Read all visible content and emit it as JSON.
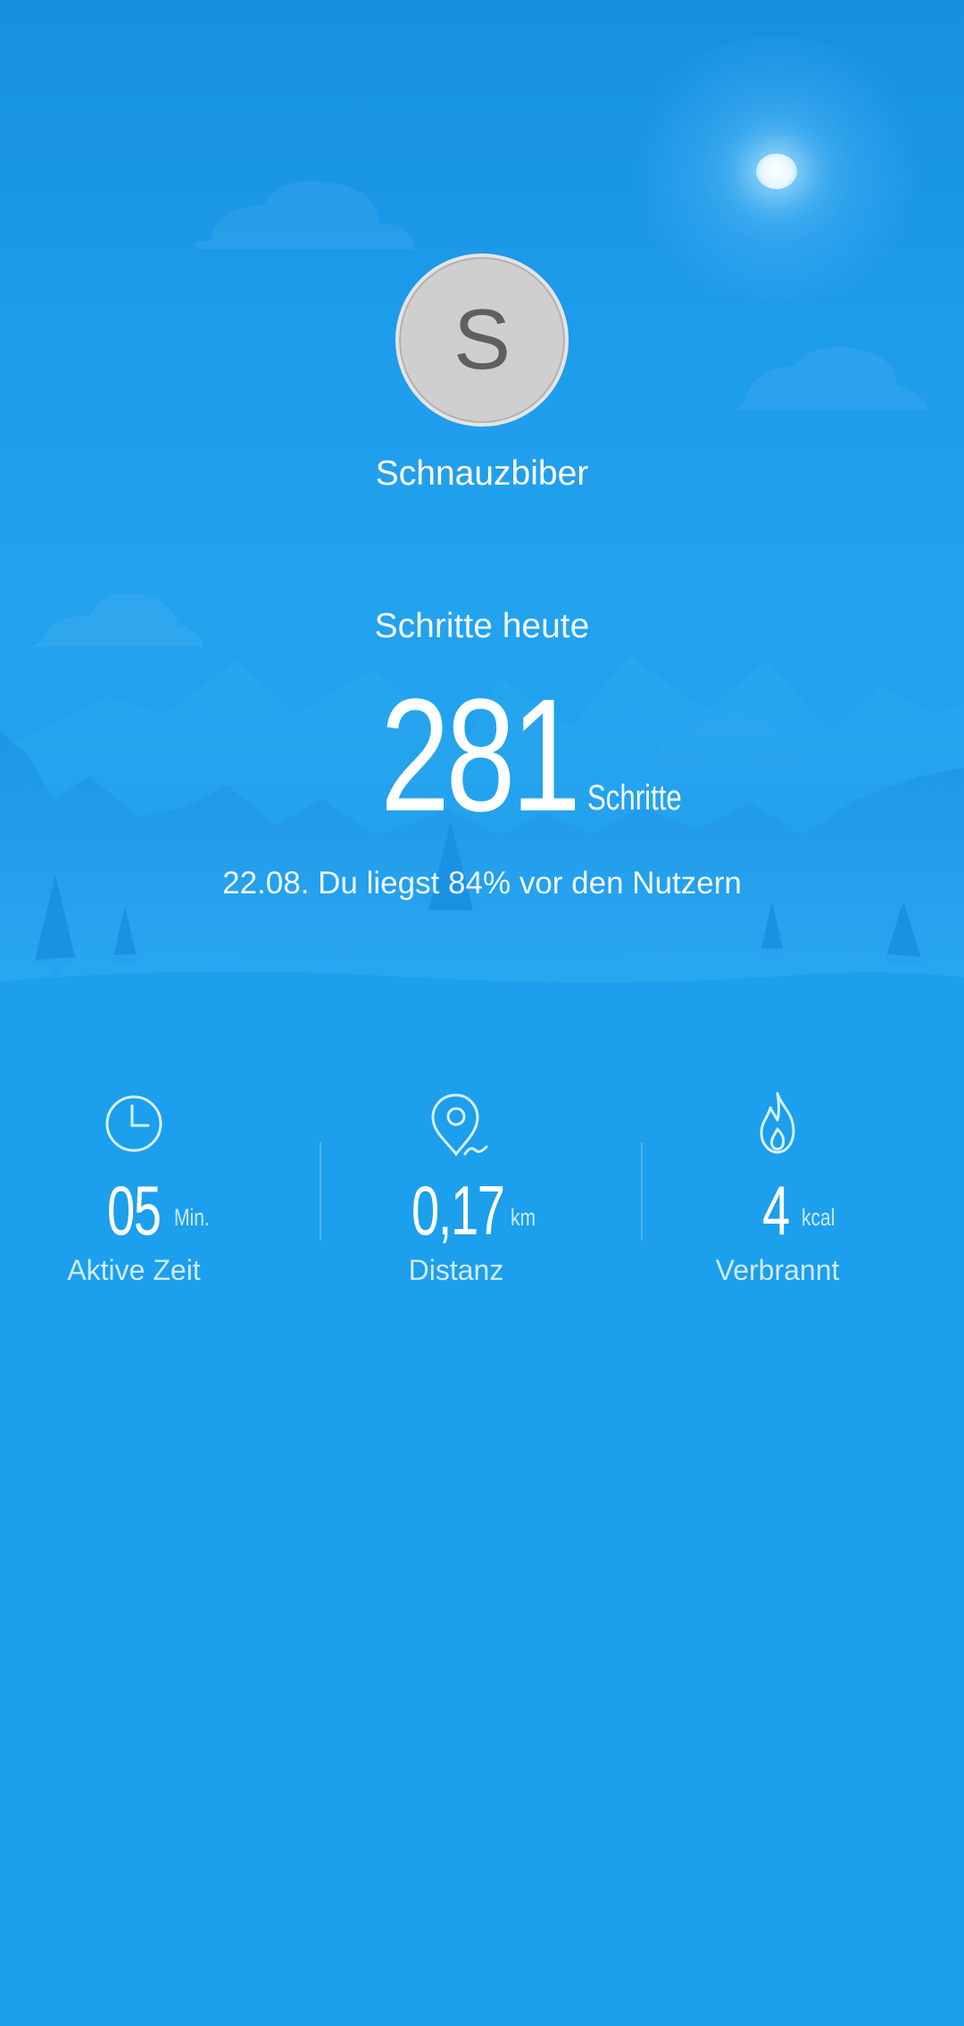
{
  "colors": {
    "background": "#1c9fec",
    "text": "#ffffff",
    "avatar_fill": "#cfcfcf",
    "avatar_letter": "#5f5f5f"
  },
  "profile": {
    "avatar_letter": "S",
    "name": "Schnauzbiber"
  },
  "steps": {
    "label": "Schritte heute",
    "value": "281",
    "unit": "Schritte",
    "summary": "22.08. Du liegst 84% vor den Nutzern"
  },
  "stats": [
    {
      "icon": "clock-icon",
      "value": "05",
      "unit": "Min.",
      "label": "Aktive Zeit"
    },
    {
      "icon": "location-pin-icon",
      "value": "0,17",
      "unit": "km",
      "label": "Distanz"
    },
    {
      "icon": "flame-icon",
      "value": "4",
      "unit": "kcal",
      "label": "Verbrannt"
    }
  ]
}
